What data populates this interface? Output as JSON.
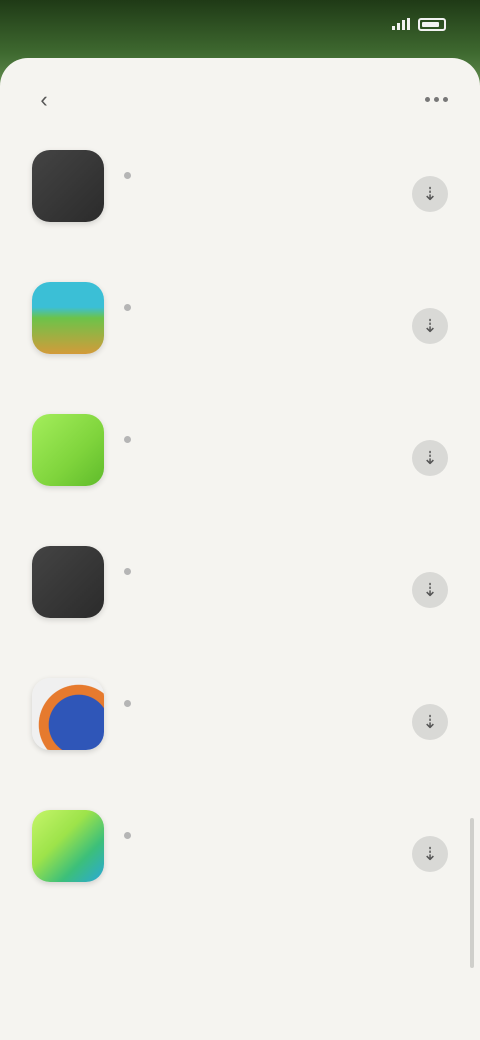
{
  "status_bar": {
    "time": "",
    "icons": [
      "signal-icon",
      "battery-icon"
    ]
  },
  "sheet": {
    "title": "",
    "back_icon": "back-icon",
    "more_icon": "more-icon"
  },
  "apps": [
    {
      "name": "",
      "description": "",
      "meta": "",
      "icon_colors": [
        "#3a3a3a",
        "#2b2b2b"
      ]
    },
    {
      "name": "",
      "description": "",
      "meta": "",
      "icon_colors": [
        "#3bbfd6",
        "#d39b3a"
      ]
    },
    {
      "name": "",
      "description": "",
      "meta": "",
      "icon_colors": [
        "#8ee34a",
        "#5fbb2b"
      ]
    },
    {
      "name": "",
      "description": "",
      "meta": "",
      "icon_colors": [
        "#3a3a3a",
        "#2b2b2b"
      ]
    },
    {
      "name": "",
      "description": "",
      "meta": "",
      "icon_colors": [
        "#e67a2e",
        "#2f56b8"
      ]
    },
    {
      "name": "",
      "description": "",
      "meta": "",
      "icon_colors": [
        "#9de34a",
        "#2aa8d8"
      ]
    }
  ],
  "footer": {
    "link_text": ""
  }
}
